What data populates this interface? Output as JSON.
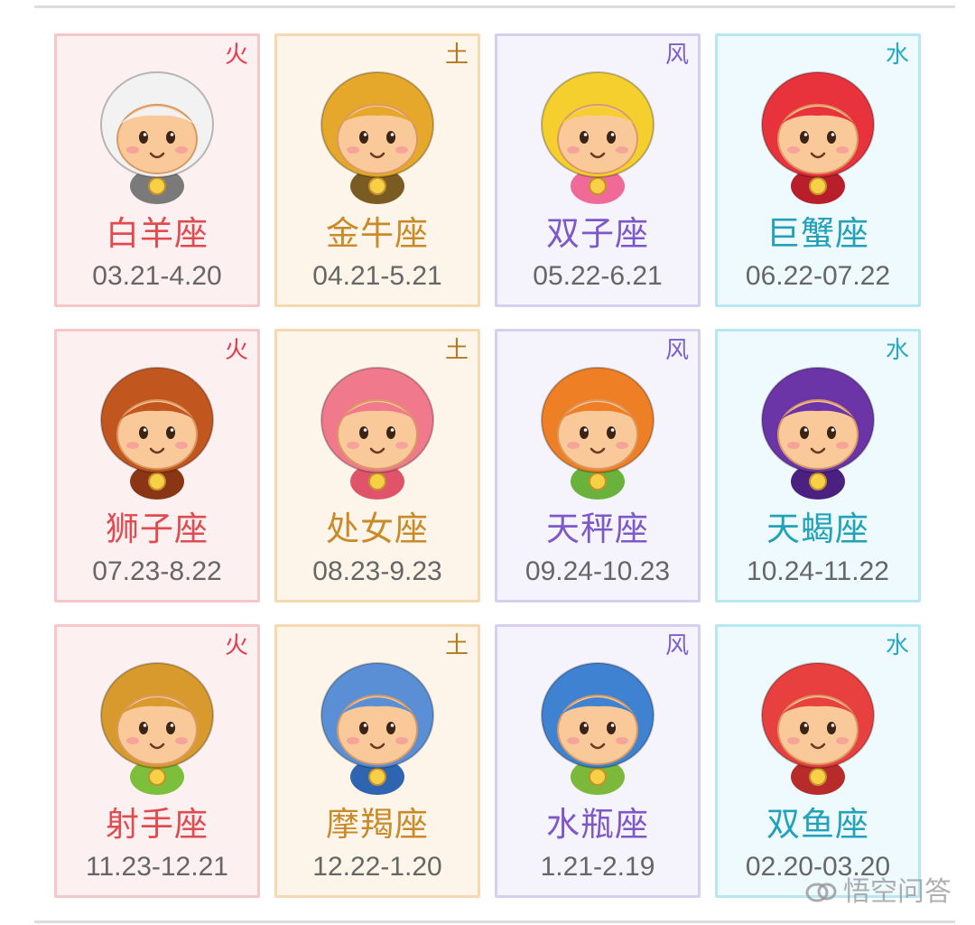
{
  "signs": [
    {
      "element": "火",
      "name": "白羊座",
      "dates": "03.21-4.20",
      "hair": "#f2f2f2",
      "accent": "#7a7a7a"
    },
    {
      "element": "土",
      "name": "金牛座",
      "dates": "04.21-5.21",
      "hair": "#e6a82b",
      "accent": "#7a5b22"
    },
    {
      "element": "风",
      "name": "双子座",
      "dates": "05.22-6.21",
      "hair": "#f5cf2e",
      "accent": "#ef6a96"
    },
    {
      "element": "水",
      "name": "巨蟹座",
      "dates": "06.22-07.22",
      "hair": "#e8323c",
      "accent": "#b91f2b"
    },
    {
      "element": "火",
      "name": "狮子座",
      "dates": "07.23-8.22",
      "hair": "#c2561f",
      "accent": "#8a3614"
    },
    {
      "element": "土",
      "name": "处女座",
      "dates": "08.23-9.23",
      "hair": "#f07a8c",
      "accent": "#e05469"
    },
    {
      "element": "风",
      "name": "天秤座",
      "dates": "09.24-10.23",
      "hair": "#ef7f24",
      "accent": "#69b23b"
    },
    {
      "element": "水",
      "name": "天蝎座",
      "dates": "10.24-11.22",
      "hair": "#6b35a8",
      "accent": "#4a2180"
    },
    {
      "element": "火",
      "name": "射手座",
      "dates": "11.23-12.21",
      "hair": "#d89a2c",
      "accent": "#7bbf3a"
    },
    {
      "element": "土",
      "name": "摩羯座",
      "dates": "12.22-1.20",
      "hair": "#5a8fd6",
      "accent": "#2f64b0"
    },
    {
      "element": "风",
      "name": "水瓶座",
      "dates": "1.21-2.19",
      "hair": "#3f82d1",
      "accent": "#7cb83a"
    },
    {
      "element": "水",
      "name": "双鱼座",
      "dates": "02.20-03.20",
      "hair": "#e8403f",
      "accent": "#b72b2b"
    }
  ],
  "element_colors": {
    "火": "#e6394a",
    "土": "#b37a1f",
    "风": "#7b5fd0",
    "水": "#25a9c8"
  },
  "watermark": {
    "text": "悟空问答",
    "icon": "wukong-logo-icon"
  }
}
